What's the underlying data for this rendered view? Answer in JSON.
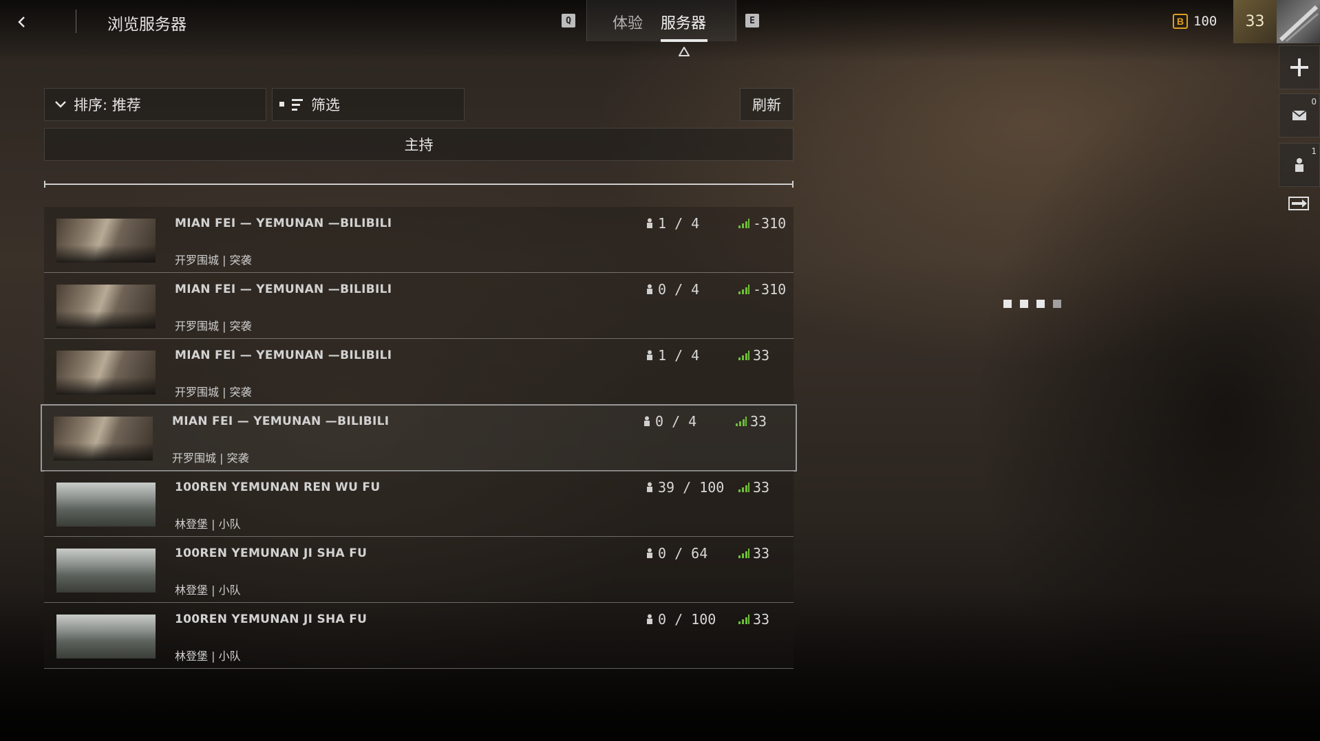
{
  "header": {
    "title": "浏览服务器",
    "left_key": "Q",
    "right_key": "E",
    "tabs": [
      {
        "label": "体验",
        "active": false
      },
      {
        "label": "服务器",
        "active": true
      }
    ],
    "currency_icon_letter": "B",
    "currency_value": "100",
    "rank_level": "33"
  },
  "right_rail": {
    "add_icon": "plus-icon",
    "mail_count": "0",
    "party_count": "1",
    "exit_icon": "exit-icon"
  },
  "toolbar": {
    "sort_label": "排序: 推荐",
    "filter_label": "筛选",
    "refresh_label": "刷新",
    "host_label": "主持"
  },
  "servers": [
    {
      "name": "MIAN FEI — YEMUNAN —BILIBILI",
      "map": "开罗围城",
      "mode": "突袭",
      "players": "1 / 4",
      "ping": "-310",
      "thumb": "cairo",
      "selected": false
    },
    {
      "name": "MIAN FEI — YEMUNAN —BILIBILI",
      "map": "开罗围城",
      "mode": "突袭",
      "players": "0 / 4",
      "ping": "-310",
      "thumb": "cairo",
      "selected": false
    },
    {
      "name": "MIAN FEI — YEMUNAN —BILIBILI",
      "map": "开罗围城",
      "mode": "突袭",
      "players": "1 / 4",
      "ping": "33",
      "thumb": "cairo",
      "selected": false
    },
    {
      "name": "MIAN FEI — YEMUNAN —BILIBILI",
      "map": "开罗围城",
      "mode": "突袭",
      "players": "0 / 4",
      "ping": "33",
      "thumb": "cairo",
      "selected": true
    },
    {
      "name": "100REN YEMUNAN REN WU FU",
      "map": "林登堡",
      "mode": "小队",
      "players": "39 / 100",
      "ping": "33",
      "thumb": "lindberg",
      "selected": false
    },
    {
      "name": "100REN YEMUNAN JI SHA FU",
      "map": "林登堡",
      "mode": "小队",
      "players": "0 / 64",
      "ping": "33",
      "thumb": "lindberg",
      "selected": false
    },
    {
      "name": "100REN YEMUNAN JI SHA FU",
      "map": "林登堡",
      "mode": "小队",
      "players": "0 / 100",
      "ping": "33",
      "thumb": "lindberg",
      "selected": false
    }
  ],
  "colors": {
    "accent_signal": "#6fbf3a",
    "currency": "#e0a020"
  }
}
